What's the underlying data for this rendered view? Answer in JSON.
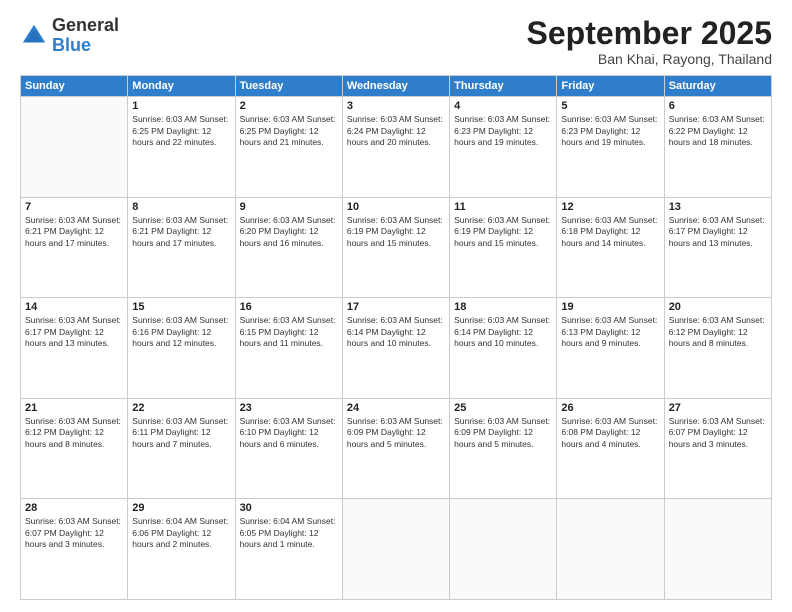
{
  "header": {
    "logo": {
      "general": "General",
      "blue": "Blue"
    },
    "month": "September 2025",
    "location": "Ban Khai, Rayong, Thailand"
  },
  "weekdays": [
    "Sunday",
    "Monday",
    "Tuesday",
    "Wednesday",
    "Thursday",
    "Friday",
    "Saturday"
  ],
  "weeks": [
    [
      {
        "day": "",
        "info": ""
      },
      {
        "day": "1",
        "info": "Sunrise: 6:03 AM\nSunset: 6:25 PM\nDaylight: 12 hours\nand 22 minutes."
      },
      {
        "day": "2",
        "info": "Sunrise: 6:03 AM\nSunset: 6:25 PM\nDaylight: 12 hours\nand 21 minutes."
      },
      {
        "day": "3",
        "info": "Sunrise: 6:03 AM\nSunset: 6:24 PM\nDaylight: 12 hours\nand 20 minutes."
      },
      {
        "day": "4",
        "info": "Sunrise: 6:03 AM\nSunset: 6:23 PM\nDaylight: 12 hours\nand 19 minutes."
      },
      {
        "day": "5",
        "info": "Sunrise: 6:03 AM\nSunset: 6:23 PM\nDaylight: 12 hours\nand 19 minutes."
      },
      {
        "day": "6",
        "info": "Sunrise: 6:03 AM\nSunset: 6:22 PM\nDaylight: 12 hours\nand 18 minutes."
      }
    ],
    [
      {
        "day": "7",
        "info": "Sunrise: 6:03 AM\nSunset: 6:21 PM\nDaylight: 12 hours\nand 17 minutes."
      },
      {
        "day": "8",
        "info": "Sunrise: 6:03 AM\nSunset: 6:21 PM\nDaylight: 12 hours\nand 17 minutes."
      },
      {
        "day": "9",
        "info": "Sunrise: 6:03 AM\nSunset: 6:20 PM\nDaylight: 12 hours\nand 16 minutes."
      },
      {
        "day": "10",
        "info": "Sunrise: 6:03 AM\nSunset: 6:19 PM\nDaylight: 12 hours\nand 15 minutes."
      },
      {
        "day": "11",
        "info": "Sunrise: 6:03 AM\nSunset: 6:19 PM\nDaylight: 12 hours\nand 15 minutes."
      },
      {
        "day": "12",
        "info": "Sunrise: 6:03 AM\nSunset: 6:18 PM\nDaylight: 12 hours\nand 14 minutes."
      },
      {
        "day": "13",
        "info": "Sunrise: 6:03 AM\nSunset: 6:17 PM\nDaylight: 12 hours\nand 13 minutes."
      }
    ],
    [
      {
        "day": "14",
        "info": "Sunrise: 6:03 AM\nSunset: 6:17 PM\nDaylight: 12 hours\nand 13 minutes."
      },
      {
        "day": "15",
        "info": "Sunrise: 6:03 AM\nSunset: 6:16 PM\nDaylight: 12 hours\nand 12 minutes."
      },
      {
        "day": "16",
        "info": "Sunrise: 6:03 AM\nSunset: 6:15 PM\nDaylight: 12 hours\nand 11 minutes."
      },
      {
        "day": "17",
        "info": "Sunrise: 6:03 AM\nSunset: 6:14 PM\nDaylight: 12 hours\nand 10 minutes."
      },
      {
        "day": "18",
        "info": "Sunrise: 6:03 AM\nSunset: 6:14 PM\nDaylight: 12 hours\nand 10 minutes."
      },
      {
        "day": "19",
        "info": "Sunrise: 6:03 AM\nSunset: 6:13 PM\nDaylight: 12 hours\nand 9 minutes."
      },
      {
        "day": "20",
        "info": "Sunrise: 6:03 AM\nSunset: 6:12 PM\nDaylight: 12 hours\nand 8 minutes."
      }
    ],
    [
      {
        "day": "21",
        "info": "Sunrise: 6:03 AM\nSunset: 6:12 PM\nDaylight: 12 hours\nand 8 minutes."
      },
      {
        "day": "22",
        "info": "Sunrise: 6:03 AM\nSunset: 6:11 PM\nDaylight: 12 hours\nand 7 minutes."
      },
      {
        "day": "23",
        "info": "Sunrise: 6:03 AM\nSunset: 6:10 PM\nDaylight: 12 hours\nand 6 minutes."
      },
      {
        "day": "24",
        "info": "Sunrise: 6:03 AM\nSunset: 6:09 PM\nDaylight: 12 hours\nand 5 minutes."
      },
      {
        "day": "25",
        "info": "Sunrise: 6:03 AM\nSunset: 6:09 PM\nDaylight: 12 hours\nand 5 minutes."
      },
      {
        "day": "26",
        "info": "Sunrise: 6:03 AM\nSunset: 6:08 PM\nDaylight: 12 hours\nand 4 minutes."
      },
      {
        "day": "27",
        "info": "Sunrise: 6:03 AM\nSunset: 6:07 PM\nDaylight: 12 hours\nand 3 minutes."
      }
    ],
    [
      {
        "day": "28",
        "info": "Sunrise: 6:03 AM\nSunset: 6:07 PM\nDaylight: 12 hours\nand 3 minutes."
      },
      {
        "day": "29",
        "info": "Sunrise: 6:04 AM\nSunset: 6:06 PM\nDaylight: 12 hours\nand 2 minutes."
      },
      {
        "day": "30",
        "info": "Sunrise: 6:04 AM\nSunset: 6:05 PM\nDaylight: 12 hours\nand 1 minute."
      },
      {
        "day": "",
        "info": ""
      },
      {
        "day": "",
        "info": ""
      },
      {
        "day": "",
        "info": ""
      },
      {
        "day": "",
        "info": ""
      }
    ]
  ]
}
